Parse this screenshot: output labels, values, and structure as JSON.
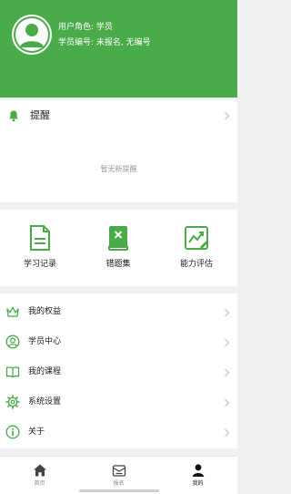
{
  "user": {
    "role_line": "用户角色: 学员",
    "id_line": "学员编号: 未报名, 无编号"
  },
  "reminder": {
    "title": "提醒",
    "empty_text": "暂无新提醒"
  },
  "quick_actions": [
    {
      "label": "学习记录",
      "icon": "document-icon"
    },
    {
      "label": "错题集",
      "icon": "book-icon"
    },
    {
      "label": "能力评估",
      "icon": "chart-trend-icon"
    }
  ],
  "menu": [
    {
      "label": "我的权益",
      "icon": "crown-icon"
    },
    {
      "label": "学员中心",
      "icon": "user-circle-icon"
    },
    {
      "label": "我的课程",
      "icon": "open-book-icon"
    },
    {
      "label": "系统设置",
      "icon": "gear-icon"
    },
    {
      "label": "关于",
      "icon": "info-icon"
    }
  ],
  "tabs": [
    {
      "label": "首页",
      "icon": "home-icon",
      "active": false
    },
    {
      "label": "报名",
      "icon": "enroll-icon",
      "active": false
    },
    {
      "label": "我的",
      "icon": "person-icon",
      "active": true
    }
  ],
  "colors": {
    "brand_green": "#4aab4a",
    "text_dark": "#222222",
    "text_muted": "#999999",
    "background": "#f1f1f1"
  }
}
